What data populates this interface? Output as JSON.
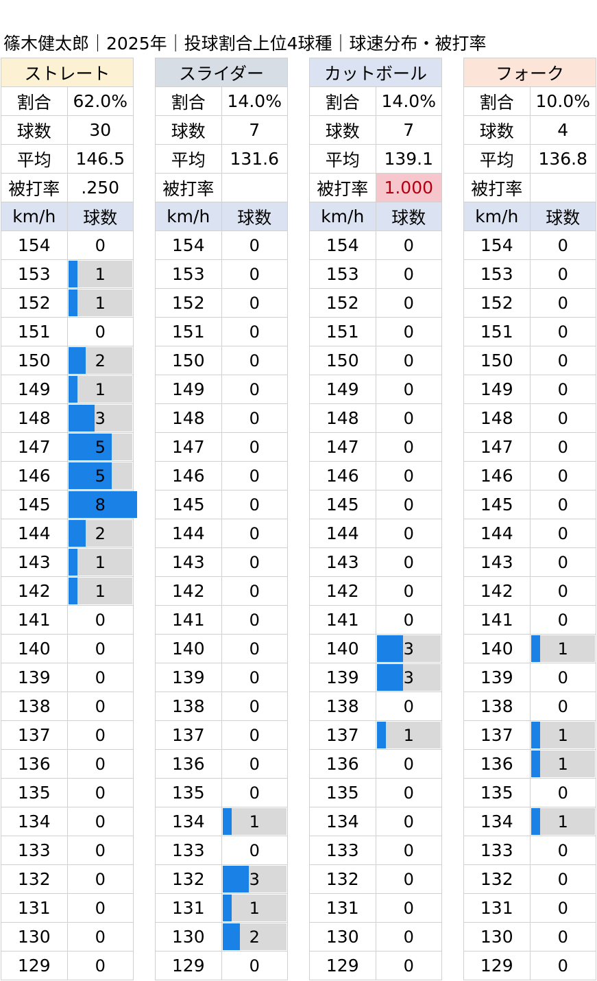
{
  "title": "篠木健太郎｜2025年｜投球割合上位4球種｜球速分布・被打率",
  "labels": {
    "ratio": "割合",
    "count": "球数",
    "avg": "平均",
    "ba": "被打率",
    "kmh": "km/h",
    "pitches": "球数"
  },
  "colors": {
    "bar": "#1a82e6",
    "bar_bg": "#d9d9d9",
    "col_head": "#dbe3f2",
    "highlight_bg": "#f7c6cd",
    "highlight_text": "#b00010"
  },
  "chart_data": {
    "type": "table",
    "speeds": [
      "154",
      "153",
      "152",
      "151",
      "150",
      "149",
      "148",
      "147",
      "146",
      "145",
      "144",
      "143",
      "142",
      "141",
      "140",
      "139",
      "138",
      "137",
      "136",
      "135",
      "134",
      "133",
      "132",
      "131",
      "130",
      "129"
    ],
    "max_count": 8,
    "pitches": [
      {
        "name": "ストレート",
        "header_bg": "#fdf1d3",
        "ratio": "62.0%",
        "count": "30",
        "avg": "146.5",
        "ba": ".250",
        "ba_highlight": false,
        "counts": [
          0,
          1,
          1,
          0,
          2,
          1,
          3,
          5,
          5,
          8,
          2,
          1,
          1,
          0,
          0,
          0,
          0,
          0,
          0,
          0,
          0,
          0,
          0,
          0,
          0,
          0
        ]
      },
      {
        "name": "スライダー",
        "header_bg": "#d6dde5",
        "ratio": "14.0%",
        "count": "7",
        "avg": "131.6",
        "ba": "",
        "ba_highlight": false,
        "counts": [
          0,
          0,
          0,
          0,
          0,
          0,
          0,
          0,
          0,
          0,
          0,
          0,
          0,
          0,
          0,
          0,
          0,
          0,
          0,
          0,
          1,
          0,
          3,
          1,
          2,
          0
        ]
      },
      {
        "name": "カットボール",
        "header_bg": "#dbe3f2",
        "ratio": "14.0%",
        "count": "7",
        "avg": "139.1",
        "ba": "1.000",
        "ba_highlight": true,
        "counts": [
          0,
          0,
          0,
          0,
          0,
          0,
          0,
          0,
          0,
          0,
          0,
          0,
          0,
          0,
          3,
          3,
          0,
          1,
          0,
          0,
          0,
          0,
          0,
          0,
          0,
          0
        ]
      },
      {
        "name": "フォーク",
        "header_bg": "#fce4d8",
        "ratio": "10.0%",
        "count": "4",
        "avg": "136.8",
        "ba": "",
        "ba_highlight": false,
        "counts": [
          0,
          0,
          0,
          0,
          0,
          0,
          0,
          0,
          0,
          0,
          0,
          0,
          0,
          0,
          1,
          0,
          0,
          1,
          1,
          0,
          1,
          0,
          0,
          0,
          0,
          0
        ]
      }
    ]
  }
}
